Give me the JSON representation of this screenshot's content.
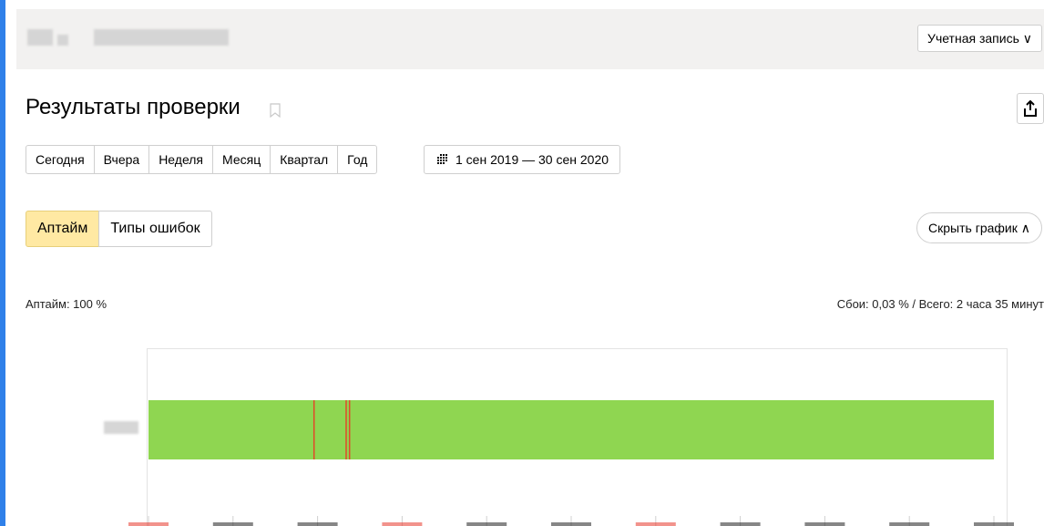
{
  "header": {
    "account_label": "Учетная запись ∨"
  },
  "page": {
    "title": "Результаты проверки",
    "export_icon": "share-export-icon",
    "bookmark_icon": "bookmark-icon"
  },
  "periods": [
    "Сегодня",
    "Вчера",
    "Неделя",
    "Месяц",
    "Квартал",
    "Год"
  ],
  "date_range": {
    "icon": "calendar-icon",
    "label": "1 сен 2019 — 30 сен 2020"
  },
  "modes": {
    "active": "Аптайм",
    "other": "Типы ошибок"
  },
  "hide_chart_label": "Скрыть график ∧",
  "summary": {
    "uptime": "Аптайм: 100 %",
    "stats": "Сбои: 0,03 % / Всего: 2 часа 35 минут"
  },
  "colors": {
    "ok": "#8fd651",
    "failure": "#e14a2a",
    "accent_tab": "#ffe9a3",
    "tick_red": "#e83a2d"
  },
  "chart_data": {
    "type": "timeline",
    "status_ok_fraction": 0.9997,
    "failure_markers": [
      0.195,
      0.233,
      0.237
    ],
    "tick_fractions": [
      0.0,
      0.1,
      0.2,
      0.3,
      0.4,
      0.5,
      0.6,
      0.7,
      0.8,
      0.9,
      1.0
    ],
    "tick_colors": [
      "#e83a2d",
      "#222",
      "#222",
      "#e83a2d",
      "#222",
      "#222",
      "#e83a2d",
      "#222",
      "#222",
      "#222",
      "#222"
    ]
  }
}
